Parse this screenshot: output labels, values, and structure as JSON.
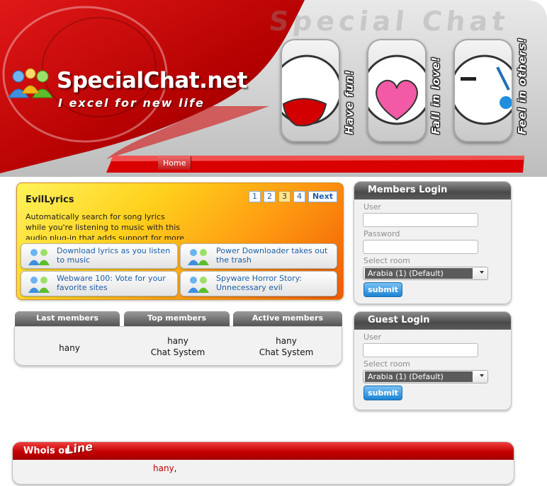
{
  "header": {
    "watermark": "Special Chat",
    "site_title": "SpecialChat.net",
    "slogan": "I excel for new life",
    "moods": [
      "Have fun!",
      "Fall in love!",
      "Feel in others!"
    ]
  },
  "nav": {
    "home": "Home"
  },
  "feature": {
    "title": "EvilLyrics",
    "pages": [
      "1",
      "2",
      "3",
      "4"
    ],
    "active_page": "3",
    "next_label": "Next",
    "description": "Automatically search for song lyrics while you're listening to music with this audio plug-in that adds support for more players.",
    "tiles": [
      "Download lyrics as you listen to music",
      "Power Downloader takes out the trash",
      "Webware 100: Vote for your favorite sites",
      "Spyware Horror Story: Unnecessary evil"
    ]
  },
  "members": {
    "tabs": [
      "Last members",
      "Top members",
      "Active members"
    ],
    "last": [
      "hany"
    ],
    "top": [
      "hany",
      "Chat System"
    ],
    "active": [
      "hany",
      "Chat System"
    ]
  },
  "members_login": {
    "title": "Members Login",
    "user_label": "User",
    "user_value": "",
    "password_label": "Password",
    "password_value": "",
    "room_label": "Select room",
    "room_value": "Arabia (1) (Default)",
    "submit": "submit"
  },
  "guest_login": {
    "title": "Guest Login",
    "user_label": "User",
    "user_value": "",
    "room_label": "Select room",
    "room_value": "Arabia (1) (Default)",
    "submit": "submit"
  },
  "whois": {
    "title_part1": "Whois on",
    "title_part2": "Line",
    "user": "hany",
    "separator": ","
  },
  "colors": {
    "brand_red": "#c40000",
    "link_blue": "#1c5ea6",
    "button_blue": "#1c83d4",
    "panel_gray": "#505050"
  }
}
